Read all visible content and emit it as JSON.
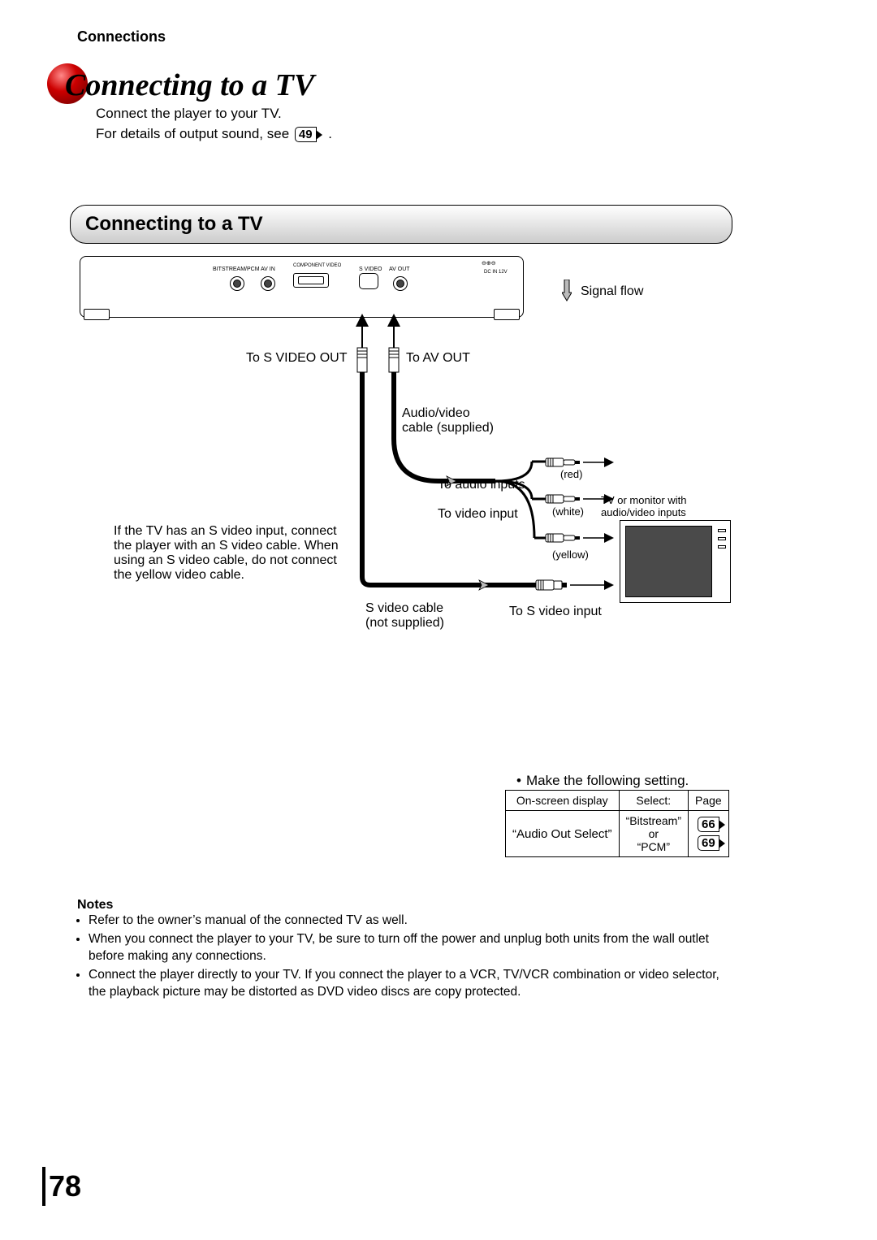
{
  "header": "Connections",
  "title": "Connecting to a TV",
  "intro_line1": "Connect the player to your TV.",
  "intro_line2_pre": "For details of output sound, see ",
  "intro_line2_ref": "49",
  "intro_line2_post": ".",
  "section_heading": "Connecting to a TV",
  "device_labels": {
    "component_video": "COMPONENT VIDEO",
    "bitstream_pcm": "BITSTREAM/PCM",
    "av_in": "AV IN",
    "s_video": "S VIDEO",
    "av_out": "AV OUT",
    "dc_in": "DC IN 12V"
  },
  "labels": {
    "signal_flow": "Signal flow",
    "to_s_video_out": "To S VIDEO OUT",
    "to_av_out": "To AV OUT",
    "audio_video_cable": "Audio/video\ncable (supplied)",
    "to_audio_inputs": "To audio inputs",
    "to_video_input": "To video input",
    "red": "(red)",
    "white": "(white)",
    "yellow": "(yellow)",
    "tv_or_monitor": "TV or monitor with audio/video inputs",
    "s_video_cable": "S video cable\n(not supplied)",
    "to_s_video_input": "To S video input",
    "s_video_explain": "If the TV has an S video input, connect the player with an S video cable. When using an S video cable, do not connect the yellow video cable."
  },
  "settings": {
    "intro": "Make the following setting.",
    "headers": [
      "On-screen display",
      "Select:",
      "Page"
    ],
    "row": {
      "display": "“Audio Out Select”",
      "select": "“Bitstream”\nor\n“PCM”",
      "pages": [
        "66",
        "69"
      ]
    }
  },
  "notes_heading": "Notes",
  "notes": [
    "Refer to the owner’s manual of the connected TV as well.",
    "When you connect the player to your TV, be sure to turn off the power and unplug both units from the wall outlet before making any connections.",
    "Connect the player directly to your TV.  If you connect the player to a VCR, TV/VCR combination or video selector, the playback picture may be distorted as DVD video discs are copy protected."
  ],
  "page_number": "78"
}
